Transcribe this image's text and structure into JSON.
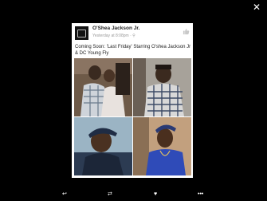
{
  "viewer": {
    "close_icon": "close-icon",
    "toolbar": [
      {
        "name": "reply-icon",
        "glyph": "↩"
      },
      {
        "name": "retweet-icon",
        "glyph": "⇄"
      },
      {
        "name": "like-icon",
        "glyph": "♥"
      },
      {
        "name": "more-icon",
        "glyph": "•••"
      }
    ]
  },
  "post": {
    "author": "O'Shea Jackson Jr.",
    "timestamp": "Yesterday at 8:08pm · ⚲",
    "caption": "Coming Soon: 'Last Friday' Starring O'shea Jackson Jr & DC Young Fly",
    "photos": [
      {
        "name": "photo-top-left"
      },
      {
        "name": "photo-top-right"
      },
      {
        "name": "photo-bottom-left"
      },
      {
        "name": "photo-bottom-right"
      }
    ]
  },
  "colors": {
    "background": "#000000",
    "card": "#ffffff",
    "text": "#222222",
    "muted": "#9a9a9a"
  }
}
